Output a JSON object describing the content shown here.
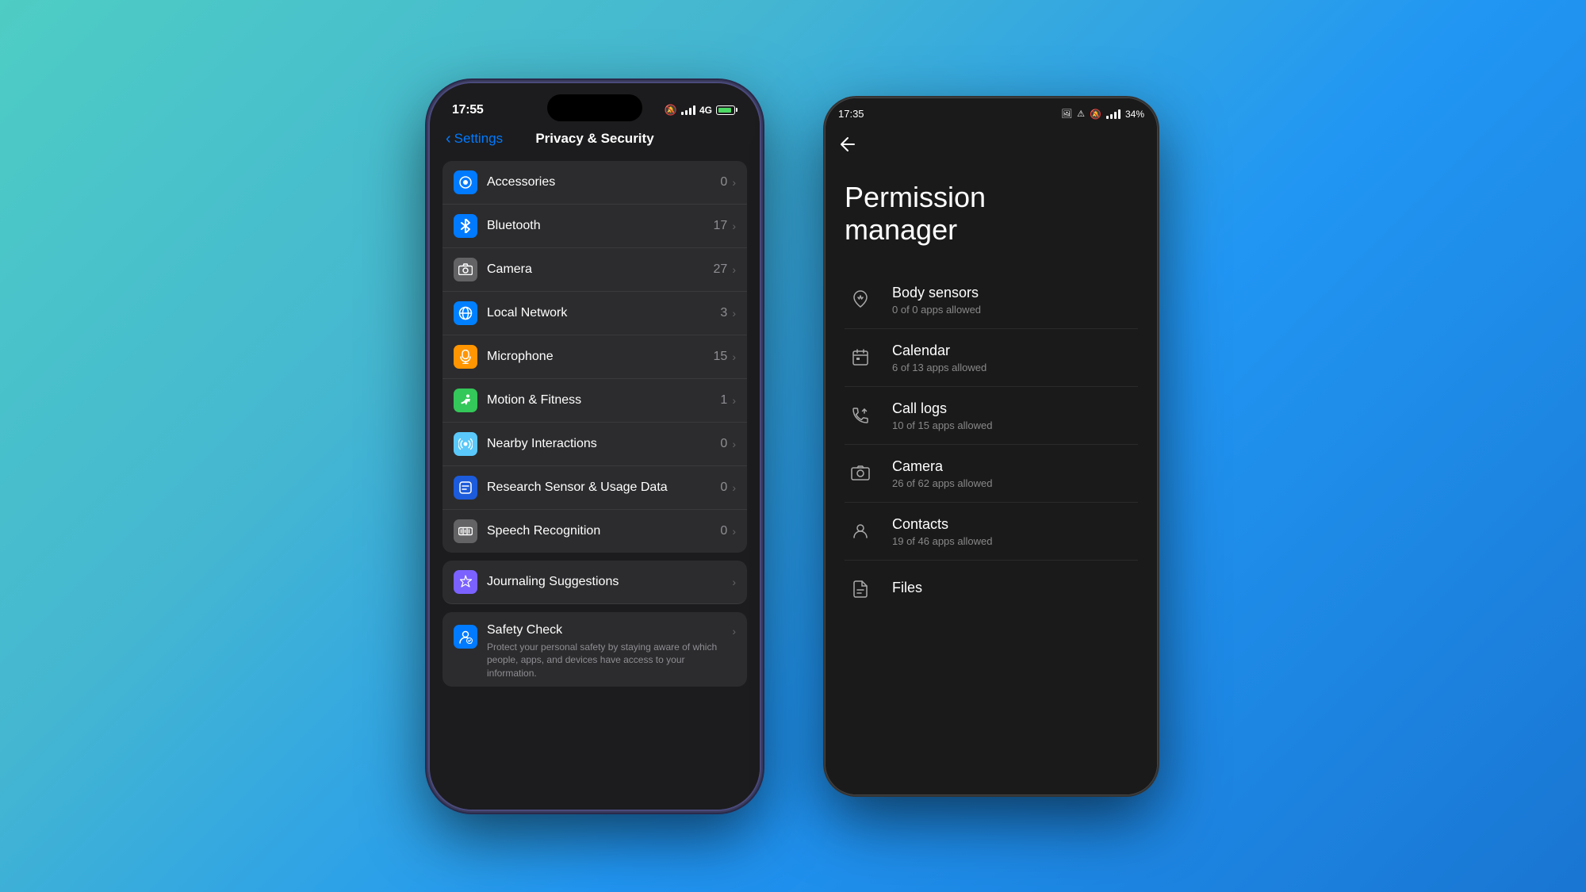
{
  "background": {
    "gradient": "linear-gradient(135deg, #4ecdc4 0%, #45b7d1 30%, #2196f3 60%, #1976d2 100%)"
  },
  "ios_phone": {
    "status_bar": {
      "time": "17:55",
      "network": "4G"
    },
    "navigation": {
      "back_label": "Settings",
      "title": "Privacy & Security"
    },
    "permissions": [
      {
        "label": "Accessories",
        "value": "0",
        "icon_type": "accessories",
        "icon_color": "blue"
      },
      {
        "label": "Bluetooth",
        "value": "17",
        "icon_type": "bluetooth",
        "icon_color": "blue"
      },
      {
        "label": "Camera",
        "value": "27",
        "icon_type": "camera",
        "icon_color": "gray"
      },
      {
        "label": "Local Network",
        "value": "3",
        "icon_type": "network",
        "icon_color": "blue"
      },
      {
        "label": "Microphone",
        "value": "15",
        "icon_type": "microphone",
        "icon_color": "orange"
      },
      {
        "label": "Motion & Fitness",
        "value": "1",
        "icon_type": "fitness",
        "icon_color": "green"
      },
      {
        "label": "Nearby Interactions",
        "value": "0",
        "icon_type": "nearby",
        "icon_color": "teal"
      },
      {
        "label": "Research Sensor & Usage Data",
        "value": "0",
        "icon_type": "research",
        "icon_color": "darkblue"
      },
      {
        "label": "Speech Recognition",
        "value": "0",
        "icon_type": "speech",
        "icon_color": "gray"
      }
    ],
    "journaling": {
      "label": "Journaling Suggestions",
      "icon_color": "purple"
    },
    "safety_check": {
      "label": "Safety Check",
      "description": "Protect your personal safety by staying aware of which people, apps, and devices have access to your information.",
      "icon_color": "blue"
    }
  },
  "android_phone": {
    "status_bar": {
      "time": "17:35",
      "battery": "34%"
    },
    "page_title": "Permission\nmanager",
    "permissions": [
      {
        "name": "Body sensors",
        "count": "0 of 0 apps allowed",
        "icon": "heart"
      },
      {
        "name": "Calendar",
        "count": "6 of 13 apps allowed",
        "icon": "calendar"
      },
      {
        "name": "Call logs",
        "count": "10 of 15 apps allowed",
        "icon": "phone"
      },
      {
        "name": "Camera",
        "count": "26 of 62 apps allowed",
        "icon": "camera"
      },
      {
        "name": "Contacts",
        "count": "19 of 46 apps allowed",
        "icon": "person"
      },
      {
        "name": "Files",
        "count": "",
        "icon": "files"
      }
    ]
  }
}
